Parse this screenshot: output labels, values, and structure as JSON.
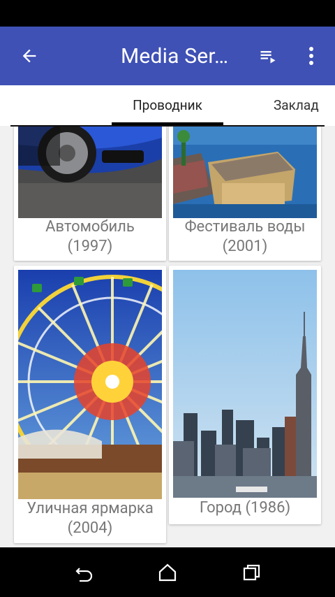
{
  "appbar": {
    "title": "Media Ser…",
    "back_icon": "arrow-back-icon",
    "queue_icon": "playlist-play-icon",
    "more_icon": "more-vert-icon",
    "color": "#3f51b5"
  },
  "tabs": [
    {
      "label": "Проводник",
      "selected": true
    },
    {
      "label": "Заклад",
      "selected": false
    }
  ],
  "media": [
    {
      "caption_line1": "Автомобиль",
      "caption_line2": "(1997)",
      "thumb": "car-image"
    },
    {
      "caption_line1": "Фестиваль воды",
      "caption_line2": "(2001)",
      "thumb": "water-festival-image"
    },
    {
      "caption_line1": "Уличная ярмарка",
      "caption_line2": "(2004)",
      "thumb": "ferris-wheel-image"
    },
    {
      "caption_line1": "Город (1986)",
      "caption_line2": "",
      "thumb": "city-skyline-image"
    }
  ],
  "navbar": {
    "back_icon": "nav-back-icon",
    "home_icon": "nav-home-icon",
    "recents_icon": "nav-recents-icon"
  }
}
